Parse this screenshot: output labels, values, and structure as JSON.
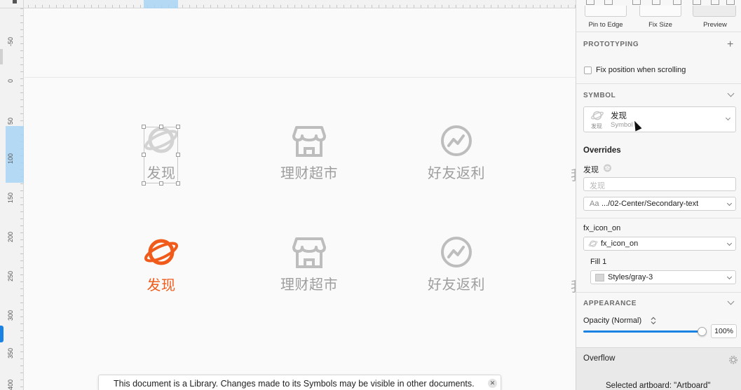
{
  "canvas": {
    "ruler_ticks": [
      "-50",
      "0",
      "50",
      "100",
      "150",
      "200",
      "250",
      "300",
      "350",
      "400"
    ],
    "tabs_row1": [
      {
        "label": "发现",
        "icon": "planet-icon",
        "active": false
      },
      {
        "label": "理财超市",
        "icon": "store-icon",
        "active": false
      },
      {
        "label": "好友返利",
        "icon": "trend-circle-icon",
        "active": false
      }
    ],
    "tabs_row2": [
      {
        "label": "发现",
        "icon": "planet-icon",
        "active": true
      },
      {
        "label": "理财超市",
        "icon": "store-icon",
        "active": false
      },
      {
        "label": "好友返利",
        "icon": "trend-circle-icon",
        "active": false
      }
    ],
    "clipped_char": "我",
    "colors": {
      "active": "#f05a1a",
      "inactive": "#bdbdbd"
    }
  },
  "notice": {
    "text": "This document is a Library. Changes made to its Symbols may be visible in other documents.",
    "close": "✕"
  },
  "inspector": {
    "pin_labels": [
      "Pin to Edge",
      "Fix Size",
      "Preview"
    ],
    "prototyping": {
      "title": "PROTOTYPING",
      "checkbox_label": "Fix position when scrolling"
    },
    "symbol": {
      "title": "SYMBOL",
      "name": "发现",
      "caption": "发现",
      "sub": "Symbol"
    },
    "overrides": {
      "title": "Overrides",
      "text_override_label": "发现",
      "text_override_placeholder": "发现",
      "text_style_prefix": "Aa",
      "text_style": ".../02-Center/Secondary-text",
      "icon_label": "fx_icon_on",
      "icon_value": "fx_icon_on",
      "fill_label": "Fill 1",
      "fill_value": "Styles/gray-3"
    },
    "appearance": {
      "title": "APPEARANCE",
      "opacity_label": "Opacity (Normal)",
      "opacity_value": "100%",
      "opacity_level": 1.0
    },
    "overflow": {
      "title": "Overflow",
      "selected": "Selected artboard: \"Artboard\""
    }
  }
}
